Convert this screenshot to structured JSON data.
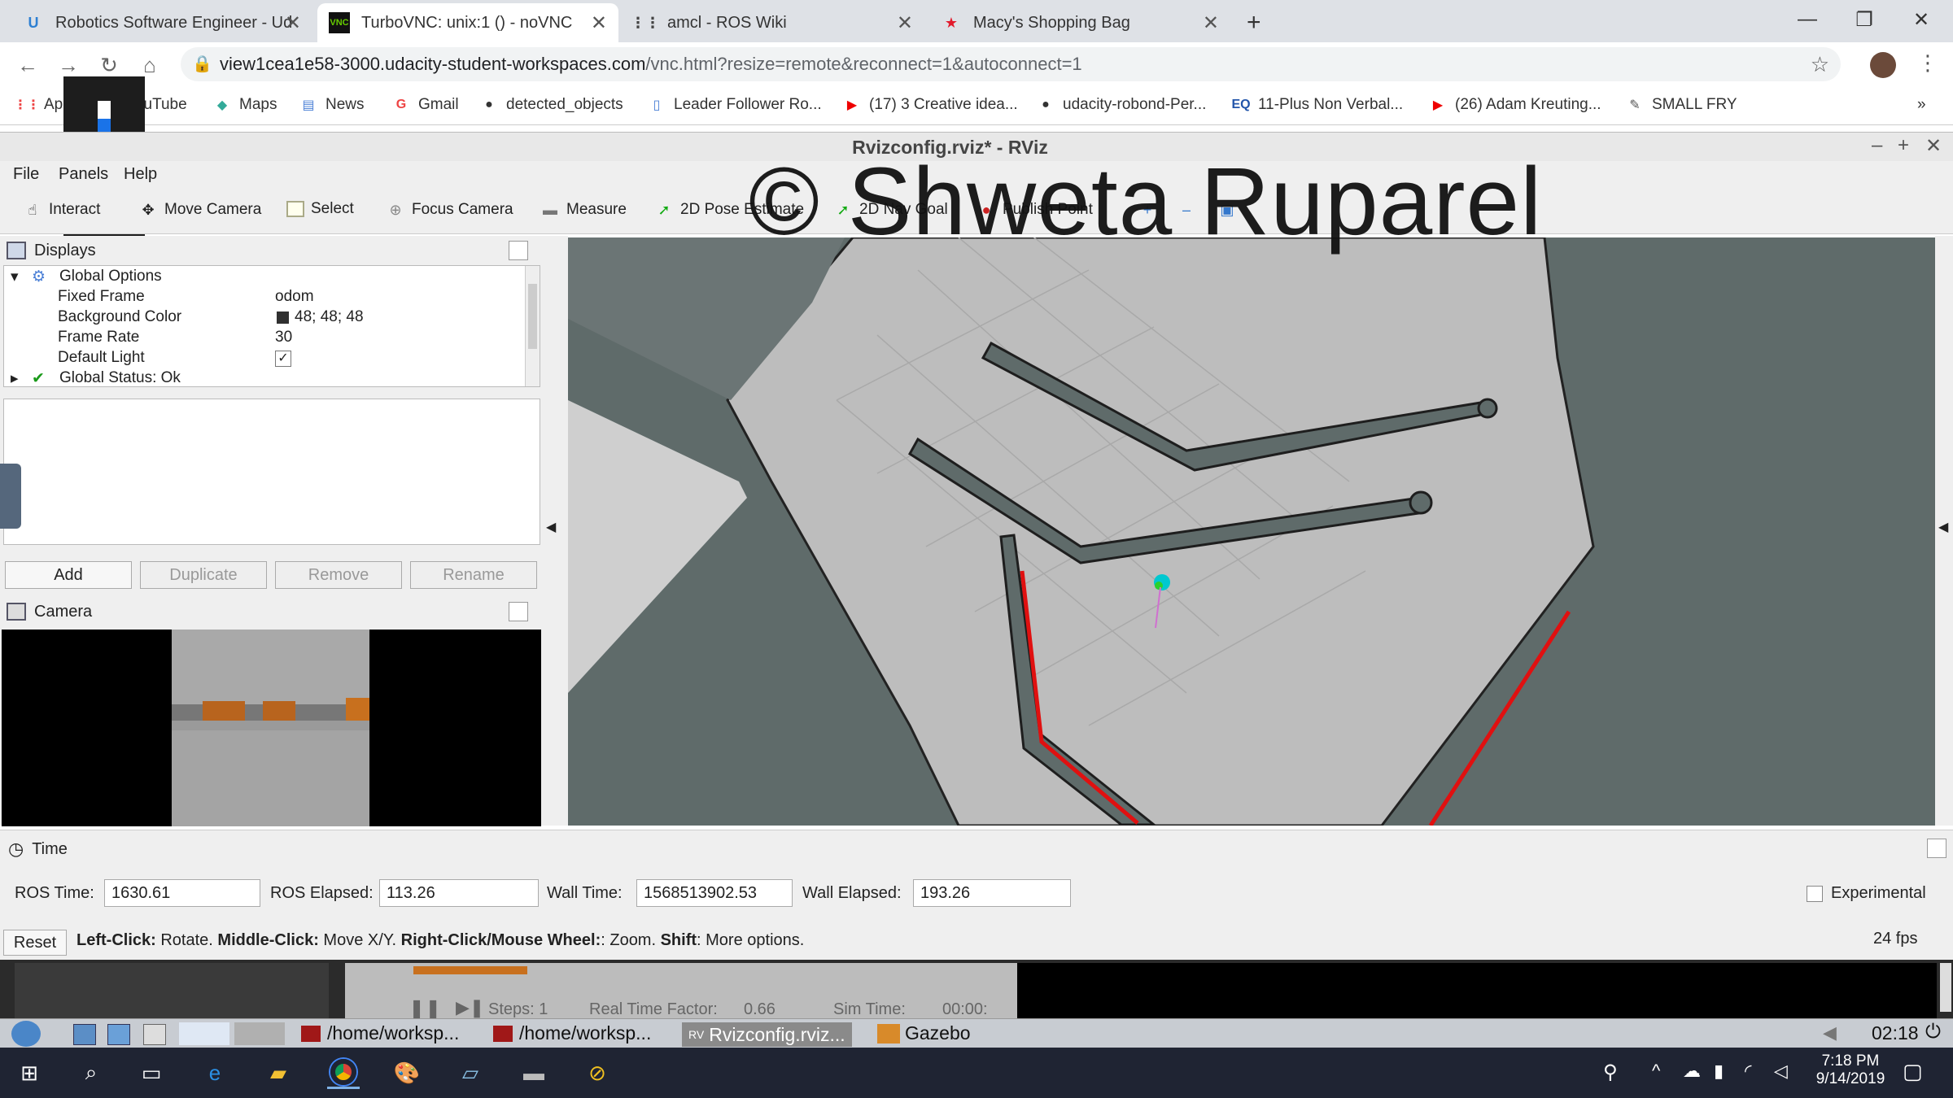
{
  "browser": {
    "tabs": [
      {
        "title": "Robotics Software Engineer - Ud",
        "icon": "udacity-icon"
      },
      {
        "title": "TurboVNC: unix:1 () - noVNC",
        "icon": "vnc-icon"
      },
      {
        "title": "amcl - ROS Wiki",
        "icon": "grid-icon"
      },
      {
        "title": "Macy's Shopping Bag",
        "icon": "star-icon"
      }
    ],
    "new_tab": "+",
    "url_host": "view1cea1e58-3000.udacity-student-workspaces.com",
    "url_path": "/vnc.html?resize=remote&reconnect=1&autoconnect=1",
    "bookmarks": [
      "Ap",
      "YouTube",
      "Maps",
      "News",
      "Gmail",
      "detected_objects",
      "Leader Follower Ro...",
      "(17) 3 Creative idea...",
      "udacity-robond-Per...",
      "11-Plus Non Verbal...",
      "(26) Adam Kreuting...",
      "SMALL FRY"
    ],
    "more_bookmarks": "»"
  },
  "rviz": {
    "title": "Rvizconfig.rviz* - RViz",
    "menus": [
      "File",
      "Panels",
      "Help"
    ],
    "tools": [
      "Interact",
      "Move Camera",
      "Select",
      "Focus Camera",
      "Measure",
      "2D Pose Estimate",
      "2D Nav Goal",
      "Publish Point"
    ],
    "watermark": "© Shweta Ruparel",
    "displays": {
      "title": "Displays",
      "rows": [
        {
          "key": "Global Options",
          "value": ""
        },
        {
          "key": "Fixed Frame",
          "value": "odom"
        },
        {
          "key": "Background Color",
          "value": "48; 48; 48"
        },
        {
          "key": "Frame Rate",
          "value": "30"
        },
        {
          "key": "Default Light",
          "value": "✓"
        },
        {
          "key": "Global Status: Ok",
          "value": ""
        }
      ],
      "buttons": [
        "Add",
        "Duplicate",
        "Remove",
        "Rename"
      ]
    },
    "camera": {
      "title": "Camera"
    },
    "time": {
      "title": "Time",
      "ros_time_label": "ROS Time:",
      "ros_time": "1630.61",
      "ros_elapsed_label": "ROS Elapsed:",
      "ros_elapsed": "113.26",
      "wall_time_label": "Wall Time:",
      "wall_time": "1568513902.53",
      "wall_elapsed_label": "Wall Elapsed:",
      "wall_elapsed": "193.26",
      "experimental": "Experimental",
      "reset": "Reset",
      "hint_lc": "Left-Click:",
      "hint_lc_v": " Rotate. ",
      "hint_mc": "Middle-Click:",
      "hint_mc_v": " Move X/Y. ",
      "hint_rc": "Right-Click/Mouse Wheel:",
      "hint_rc_v": ": Zoom. ",
      "hint_sh": "Shift",
      "hint_sh_v": ": More options.",
      "fps": "24 fps"
    }
  },
  "gazebo_bar": {
    "steps": "Steps: 1",
    "rtf_label": "Real Time Factor:",
    "rtf": "0.66",
    "sim_label": "Sim Time:",
    "sim": "00:00:"
  },
  "xtask": {
    "items": [
      "/home/worksp...",
      "/home/worksp...",
      "Rvizconfig.rviz...",
      "Gazebo"
    ],
    "clock": "02:18"
  },
  "windows": {
    "time": "7:18 PM",
    "date": "9/14/2019"
  }
}
